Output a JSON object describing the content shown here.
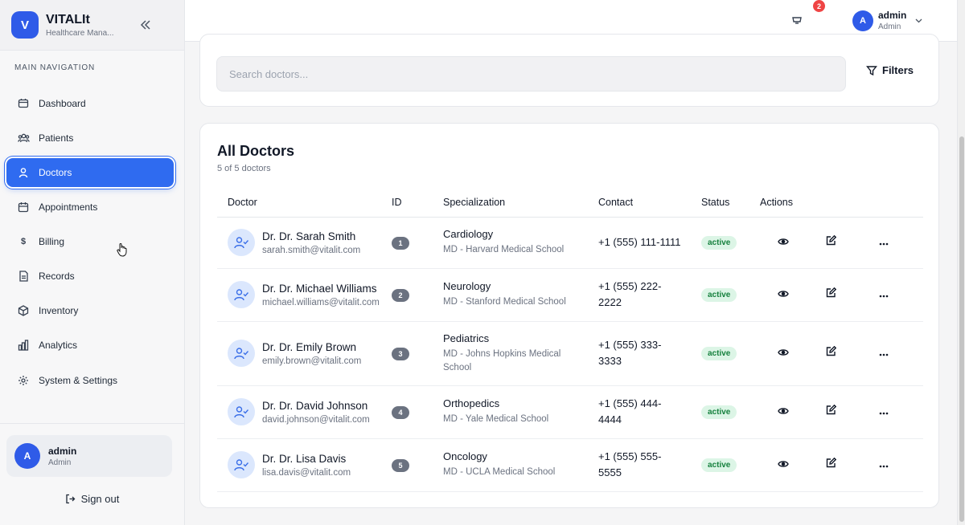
{
  "brand": {
    "logo_letter": "V",
    "name": "VITALIt",
    "subtitle": "Healthcare Mana..."
  },
  "nav": {
    "heading": "MAIN NAVIGATION",
    "items": [
      {
        "label": "Dashboard",
        "icon": "dashboard-icon"
      },
      {
        "label": "Patients",
        "icon": "patients-icon"
      },
      {
        "label": "Doctors",
        "icon": "doctor-icon",
        "active": true
      },
      {
        "label": "Appointments",
        "icon": "calendar-icon"
      },
      {
        "label": "Billing",
        "icon": "dollar-icon"
      },
      {
        "label": "Records",
        "icon": "document-icon"
      },
      {
        "label": "Inventory",
        "icon": "box-icon"
      },
      {
        "label": "Analytics",
        "icon": "bar-chart-icon"
      },
      {
        "label": "System & Settings",
        "icon": "gear-icon"
      }
    ]
  },
  "sidebar_user": {
    "initial": "A",
    "name": "admin",
    "role": "Admin"
  },
  "signout_label": "Sign out",
  "topbar": {
    "notification_count": "2",
    "user": {
      "initial": "A",
      "name": "admin",
      "role": "Admin"
    }
  },
  "search": {
    "placeholder": "Search doctors...",
    "filters_label": "Filters"
  },
  "card": {
    "title": "All Doctors",
    "subtitle": "5 of 5 doctors",
    "columns": [
      "Doctor",
      "ID",
      "Specialization",
      "Contact",
      "Status",
      "Actions"
    ]
  },
  "doctors": [
    {
      "name": "Dr. Dr. Sarah Smith",
      "email": "sarah.smith@vitalit.com",
      "id": "1",
      "specialization": "Cardiology",
      "school": "MD - Harvard Medical School",
      "contact": "+1 (555) 111-1111",
      "status": "active"
    },
    {
      "name": "Dr. Dr. Michael Williams",
      "email": "michael.williams@vitalit.com",
      "id": "2",
      "specialization": "Neurology",
      "school": "MD - Stanford Medical School",
      "contact": "+1 (555) 222-2222",
      "status": "active"
    },
    {
      "name": "Dr. Dr. Emily Brown",
      "email": "emily.brown@vitalit.com",
      "id": "3",
      "specialization": "Pediatrics",
      "school": "MD - Johns Hopkins Medical School",
      "contact": "+1 (555) 333-3333",
      "status": "active"
    },
    {
      "name": "Dr. Dr. David Johnson",
      "email": "david.johnson@vitalit.com",
      "id": "4",
      "specialization": "Orthopedics",
      "school": "MD - Yale Medical School",
      "contact": "+1 (555) 444-4444",
      "status": "active"
    },
    {
      "name": "Dr. Dr. Lisa Davis",
      "email": "lisa.davis@vitalit.com",
      "id": "5",
      "specialization": "Oncology",
      "school": "MD - UCLA Medical School",
      "contact": "+1 (555) 555-5555",
      "status": "active"
    }
  ],
  "colors": {
    "accent": "#2f6bf0",
    "status_active_bg": "#dcf5e6",
    "status_active_text": "#15803d",
    "badge": "#ef4444"
  }
}
